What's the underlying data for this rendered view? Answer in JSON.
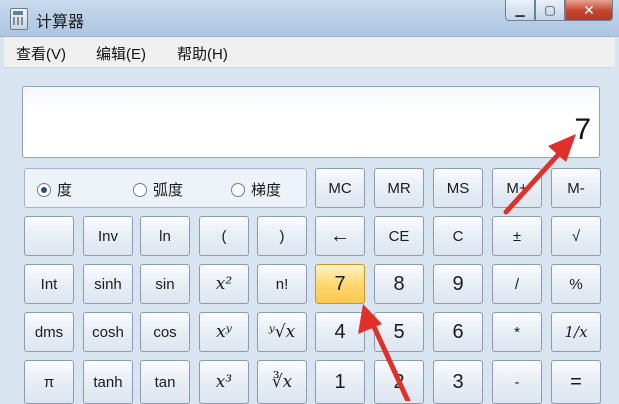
{
  "window": {
    "title": "计算器",
    "minimize_icon": "minimize-icon",
    "maximize_icon": "maximize-icon",
    "close_icon": "close-icon"
  },
  "menu": [
    "查看(V)",
    "编辑(E)",
    "帮助(H)"
  ],
  "display": {
    "value": "7"
  },
  "angle_units": {
    "options": [
      "度",
      "弧度",
      "梯度"
    ],
    "selected": "度"
  },
  "memory_buttons": [
    "MC",
    "MR",
    "MS",
    "M+",
    "M-"
  ],
  "rows": [
    [
      "",
      "Inv",
      "ln",
      "(",
      ")",
      "←",
      "CE",
      "C",
      "±",
      "√"
    ],
    [
      "Int",
      "sinh",
      "sin",
      "x²",
      "n!",
      "7",
      "8",
      "9",
      "/",
      "%"
    ],
    [
      "dms",
      "cosh",
      "cos",
      "xʸ",
      "ʸ√x",
      "4",
      "5",
      "6",
      "*",
      "1/x"
    ],
    [
      "π",
      "tanh",
      "tan",
      "x³",
      "∛x",
      "1",
      "2",
      "3",
      "-",
      "="
    ]
  ],
  "highlighted_key": "7",
  "colors": {
    "accent_arrow": "#e0302a",
    "active_key": "#ffd872"
  }
}
